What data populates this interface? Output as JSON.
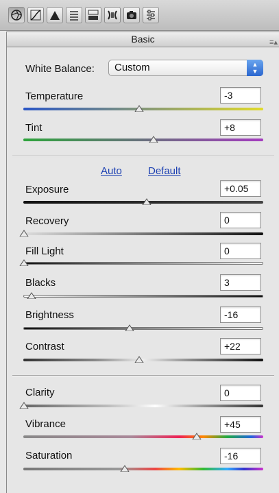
{
  "toolbar": {
    "tabs": [
      {
        "name": "basic-tab",
        "icon": "aperture-icon"
      },
      {
        "name": "tone-curve-tab",
        "icon": "tone-curve-icon"
      },
      {
        "name": "detail-tab",
        "icon": "detail-triangle-icon"
      },
      {
        "name": "hsl-tab",
        "icon": "hsl-bars-icon"
      },
      {
        "name": "split-toning-tab",
        "icon": "split-toning-icon"
      },
      {
        "name": "lens-corrections-tab",
        "icon": "lens-icon"
      },
      {
        "name": "camera-calibration-tab",
        "icon": "camera-icon"
      },
      {
        "name": "presets-tab",
        "icon": "presets-icon"
      }
    ]
  },
  "panel": {
    "title": "Basic",
    "menu_icon": "panel-menu-icon"
  },
  "white_balance": {
    "label": "White Balance:",
    "value": "Custom"
  },
  "links": {
    "auto": "Auto",
    "default": "Default"
  },
  "controls": {
    "temperature": {
      "label": "Temperature",
      "value": "-3",
      "position": 0.48
    },
    "tint": {
      "label": "Tint",
      "value": "+8",
      "position": 0.54
    },
    "exposure": {
      "label": "Exposure",
      "value": "+0.05",
      "position": 0.51
    },
    "recovery": {
      "label": "Recovery",
      "value": "0",
      "position": 0.0
    },
    "fill_light": {
      "label": "Fill Light",
      "value": "0",
      "position": 0.0
    },
    "blacks": {
      "label": "Blacks",
      "value": "3",
      "position": 0.03
    },
    "brightness": {
      "label": "Brightness",
      "value": "-16",
      "position": 0.44
    },
    "contrast": {
      "label": "Contrast",
      "value": "+22",
      "position": 0.48
    },
    "clarity": {
      "label": "Clarity",
      "value": "0",
      "position": 0.0
    },
    "vibrance": {
      "label": "Vibrance",
      "value": "+45",
      "position": 0.72
    },
    "saturation": {
      "label": "Saturation",
      "value": "-16",
      "position": 0.42
    }
  },
  "colors": {
    "link": "#1c40b2",
    "temperature_track": [
      "#2a56c6",
      "#e0da2b"
    ],
    "tint_track": [
      "#2ea43c",
      "#a43cbf"
    ]
  }
}
